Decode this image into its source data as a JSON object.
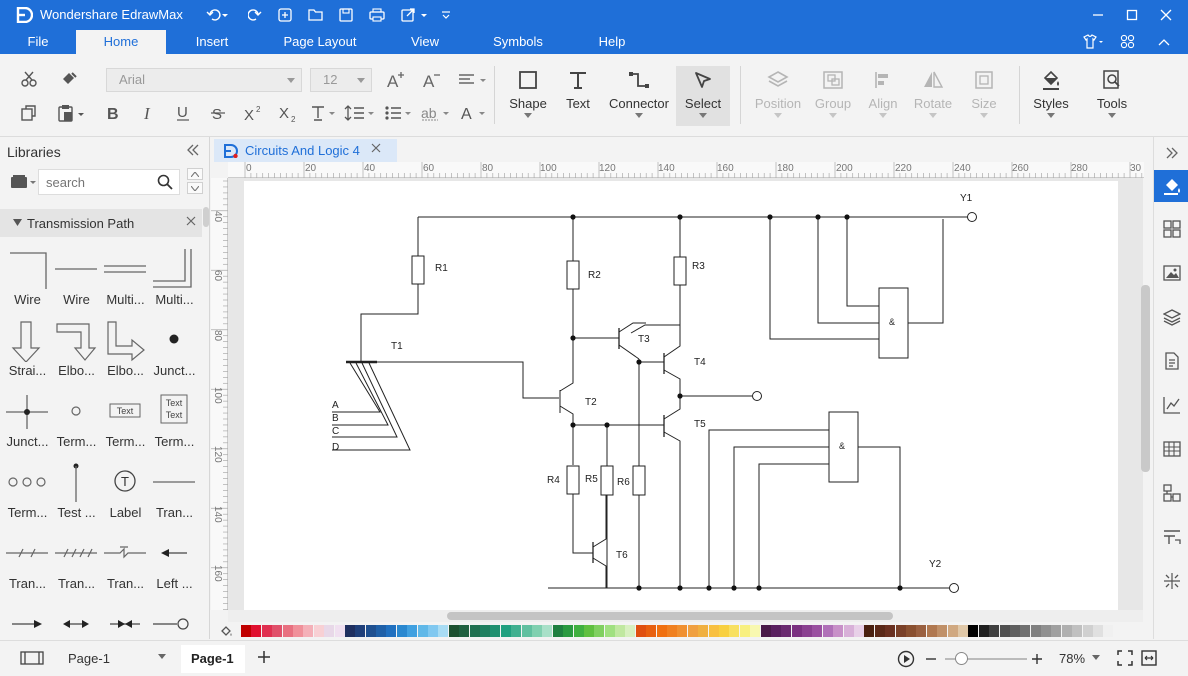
{
  "app": {
    "title": "Wondershare EdrawMax"
  },
  "menu": {
    "tabs": [
      "File",
      "Home",
      "Insert",
      "Page Layout",
      "View",
      "Symbols",
      "Help"
    ],
    "active": "Home"
  },
  "ribbon": {
    "font_family": "Arial",
    "font_size": "12",
    "tools": {
      "shape": "Shape",
      "text": "Text",
      "connector": "Connector",
      "select": "Select",
      "position": "Position",
      "group": "Group",
      "align": "Align",
      "rotate": "Rotate",
      "size": "Size",
      "styles": "Styles",
      "tools": "Tools"
    }
  },
  "libraries": {
    "title": "Libraries",
    "search_placeholder": "search",
    "category": "Transmission Path",
    "shapes": [
      [
        "Wire",
        "Wire",
        "Multi...",
        "Multi..."
      ],
      [
        "Strai...",
        "Elbo...",
        "Elbo...",
        "Junct..."
      ],
      [
        "Junct...",
        "Term...",
        "Term...",
        "Term..."
      ],
      [
        "Term...",
        "Test ...",
        "Label",
        "Tran..."
      ],
      [
        "Tran...",
        "Tran...",
        "Tran...",
        "Left ..."
      ],
      [
        "",
        "",
        "",
        ""
      ]
    ],
    "shape_texts": {
      "text": "Text",
      "text_box_line1": "Text",
      "text_box_line2": "Text",
      "label_glyph": "T"
    }
  },
  "document": {
    "tab_name": "Circuits And Logic 4"
  },
  "rulers": {
    "h": [
      "0",
      "20",
      "40",
      "60",
      "80",
      "100",
      "120",
      "140",
      "160",
      "180",
      "200",
      "220",
      "240",
      "260",
      "280",
      "30"
    ],
    "v": [
      "40",
      "60",
      "80",
      "100",
      "120",
      "140",
      "160"
    ]
  },
  "circuit": {
    "labels": [
      "R1",
      "R2",
      "R3",
      "T1",
      "T2",
      "T3",
      "T4",
      "T5",
      "T6",
      "R4",
      "R5",
      "R6",
      "Y1",
      "Y2",
      "A",
      "B",
      "C",
      "D"
    ],
    "gate_symbol": "&"
  },
  "palette": {
    "colors": [
      "#c00000",
      "#e0102f",
      "#e03050",
      "#e0506a",
      "#e87080",
      "#f0909a",
      "#f4b0b8",
      "#f8d0d4",
      "#e8d8e8",
      "#f0e0f0",
      "#203060",
      "#20407a",
      "#1f5090",
      "#1f60a8",
      "#2070c0",
      "#2a88d0",
      "#40a0e0",
      "#60b8e8",
      "#80c8f0",
      "#a8dcf4",
      "#1c5030",
      "#1f6040",
      "#207050",
      "#208060",
      "#209070",
      "#20a080",
      "#40b090",
      "#60c0a0",
      "#80d0b0",
      "#a8e0c8",
      "#1f8040",
      "#2a9a40",
      "#40b040",
      "#60c040",
      "#80d060",
      "#a0e080",
      "#c0e8a0",
      "#d8f0c0",
      "#e05010",
      "#e86010",
      "#f07010",
      "#f08020",
      "#f09030",
      "#f0a040",
      "#f0b040",
      "#f8c040",
      "#f8d040",
      "#f8e060",
      "#f8f080",
      "#f8f8b0",
      "#4a1a4a",
      "#5a2060",
      "#6a2a70",
      "#7a3080",
      "#8a4090",
      "#9a50a0",
      "#b070b8",
      "#c890c8",
      "#d8b0d8",
      "#e8d0e8",
      "#4a2010",
      "#5a2818",
      "#6a3020",
      "#7a4028",
      "#8a5030",
      "#9a6040",
      "#b07850",
      "#c09068",
      "#d0a880",
      "#e0c8a8",
      "#000000",
      "#202020",
      "#404040",
      "#505050",
      "#606060",
      "#707070",
      "#808080",
      "#909090",
      "#a0a0a0",
      "#b0b0b0",
      "#c0c0c0",
      "#d0d0d0",
      "#e0e0e0",
      "#f0f0f0"
    ]
  },
  "status": {
    "page_select": "Page-1",
    "page_tab": "Page-1",
    "zoom": "78%"
  }
}
